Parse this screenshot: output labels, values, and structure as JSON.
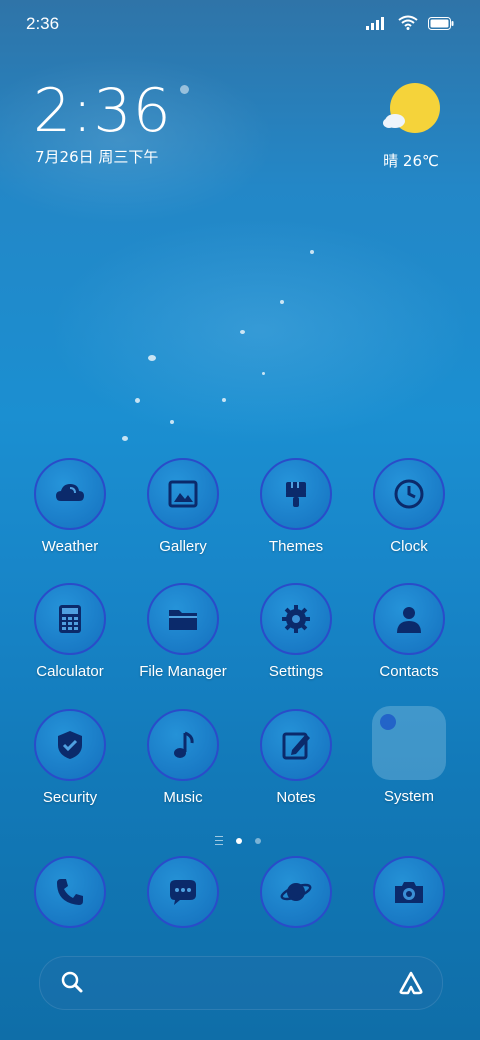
{
  "status_bar": {
    "time": "2:36"
  },
  "clock_widget": {
    "time": "2:36",
    "date": "7月26日 周三下午"
  },
  "weather_widget": {
    "text": "晴 26℃"
  },
  "apps": [
    {
      "label": "Weather",
      "icon": "cloud-icon"
    },
    {
      "label": "Gallery",
      "icon": "image-icon"
    },
    {
      "label": "Themes",
      "icon": "paintbrush-icon"
    },
    {
      "label": "Clock",
      "icon": "clock-icon"
    },
    {
      "label": "Calculator",
      "icon": "calculator-icon"
    },
    {
      "label": "File Manager",
      "icon": "folder-icon"
    },
    {
      "label": "Settings",
      "icon": "gear-icon"
    },
    {
      "label": "Contacts",
      "icon": "person-icon"
    },
    {
      "label": "Security",
      "icon": "shield-check-icon"
    },
    {
      "label": "Music",
      "icon": "music-note-icon"
    },
    {
      "label": "Notes",
      "icon": "note-pencil-icon"
    },
    {
      "label": "System",
      "icon": "folder-group-icon"
    }
  ],
  "dock": [
    {
      "icon": "phone-icon"
    },
    {
      "icon": "message-icon"
    },
    {
      "icon": "planet-icon"
    },
    {
      "icon": "camera-icon"
    }
  ],
  "page_indicator": {
    "pages": 2,
    "current": 1
  },
  "colors": {
    "icon_border": "#2a4cc9",
    "icon_glyph": "#0b2a6b",
    "sun": "#f5d33a"
  }
}
